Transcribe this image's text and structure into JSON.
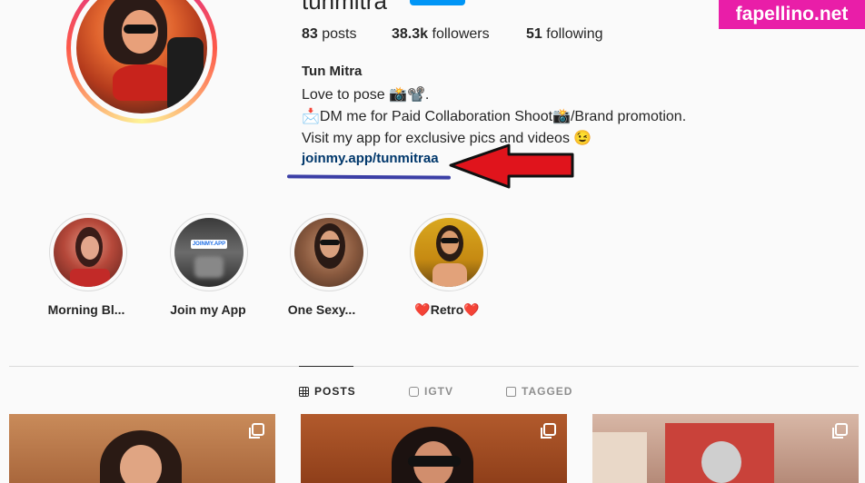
{
  "profile": {
    "username": "tunmitra",
    "posts_count": "83",
    "posts_label": "posts",
    "followers_count": "38.3k",
    "followers_label": "followers",
    "following_count": "51",
    "following_label": "following",
    "full_name": "Tun Mitra",
    "bio_line1": "Love to pose 📸📽️.",
    "bio_line2": "📩DM me for Paid Collaboration Shoot📸/Brand promotion.",
    "bio_line3": "Visit my app for exclusive pics and videos 😉",
    "link": "joinmy.app/tunmitraa"
  },
  "highlights": [
    {
      "label": "Morning Bl..."
    },
    {
      "label": "Join my App",
      "badge": "JOINMY.APP"
    },
    {
      "label": "One Sexy..."
    },
    {
      "label": "❤️Retro❤️"
    }
  ],
  "tabs": [
    {
      "label": "POSTS",
      "icon": "grid-icon"
    },
    {
      "label": "IGTV",
      "icon": "igtv-icon"
    },
    {
      "label": "TAGGED",
      "icon": "tagged-icon"
    }
  ],
  "watermark": "fapellino.net",
  "colors": {
    "accent": "#0095f6",
    "link": "#00376b",
    "arrow": "#e0141c",
    "watermark_bg": "#e91ea8"
  }
}
